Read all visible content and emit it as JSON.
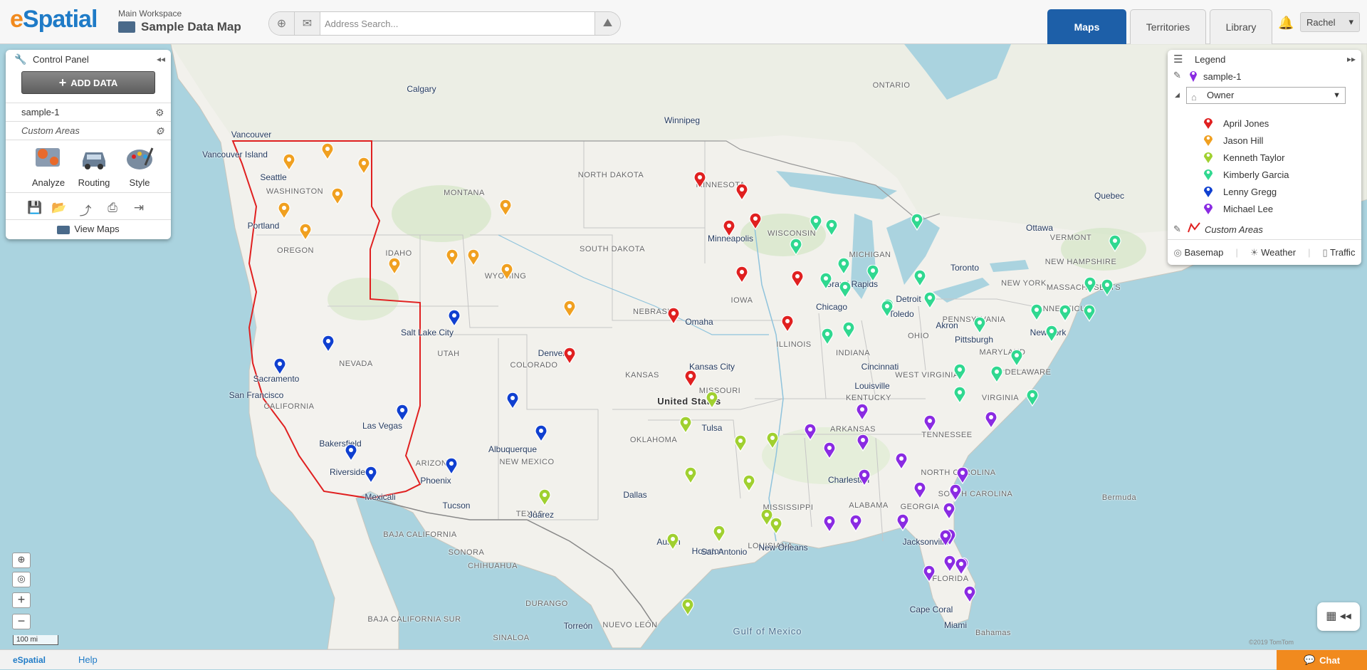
{
  "header": {
    "logo_prefix": "e",
    "logo_rest": "Spatial",
    "workspace": "Main Workspace",
    "map_title": "Sample Data Map",
    "search_placeholder": "Address Search...",
    "tabs": [
      {
        "label": "Maps",
        "active": true
      },
      {
        "label": "Territories",
        "active": false
      },
      {
        "label": "Library",
        "active": false
      }
    ],
    "user": "Rachel"
  },
  "control_panel": {
    "title": "Control Panel",
    "add_data_label": "ADD DATA",
    "dataset": "sample-1",
    "custom_areas": "Custom Areas",
    "tools": [
      {
        "label": "Analyze",
        "icon": "analyze-icon"
      },
      {
        "label": "Routing",
        "icon": "car-icon"
      },
      {
        "label": "Style",
        "icon": "palette-icon"
      }
    ],
    "actions": [
      "save-icon",
      "folder-open-icon",
      "share-icon",
      "print-icon",
      "export-icon"
    ],
    "view_maps": "View Maps"
  },
  "legend": {
    "title": "Legend",
    "layer": "sample-1",
    "group_by": "Owner",
    "owners": [
      {
        "name": "April Jones",
        "color": "#e02020"
      },
      {
        "name": "Jason Hill",
        "color": "#f0a020"
      },
      {
        "name": "Kenneth Taylor",
        "color": "#a0d030"
      },
      {
        "name": "Kimberly Garcia",
        "color": "#30d890"
      },
      {
        "name": "Lenny Gregg",
        "color": "#1040d0"
      },
      {
        "name": "Michael Lee",
        "color": "#8a2be2"
      }
    ],
    "custom_areas": "Custom Areas",
    "footer": [
      "Basemap",
      "Weather",
      "Traffic"
    ]
  },
  "map": {
    "scale": "100 mi",
    "copyright": "©2019 TomTom",
    "labels": [
      {
        "t": "Calgary",
        "k": "city"
      },
      {
        "t": "Winnipeg",
        "k": "city"
      },
      {
        "t": "ONTARIO",
        "k": "region"
      },
      {
        "t": "Vancouver",
        "k": "city"
      },
      {
        "t": "Vancouver Island",
        "k": "city"
      },
      {
        "t": "Seattle",
        "k": "city"
      },
      {
        "t": "WASHINGTON",
        "k": "region"
      },
      {
        "t": "Portland",
        "k": "city"
      },
      {
        "t": "OREGON",
        "k": "region"
      },
      {
        "t": "MONTANA",
        "k": "region"
      },
      {
        "t": "IDAHO",
        "k": "region"
      },
      {
        "t": "WYOMING",
        "k": "region"
      },
      {
        "t": "NORTH DAKOTA",
        "k": "region"
      },
      {
        "t": "SOUTH DAKOTA",
        "k": "region"
      },
      {
        "t": "MINNESOTA",
        "k": "region"
      },
      {
        "t": "Minneapolis",
        "k": "city"
      },
      {
        "t": "WISCONSIN",
        "k": "region"
      },
      {
        "t": "MICHIGAN",
        "k": "region"
      },
      {
        "t": "Quebec",
        "k": "city"
      },
      {
        "t": "Ottawa",
        "k": "city"
      },
      {
        "t": "Toronto",
        "k": "city"
      },
      {
        "t": "VERMONT",
        "k": "region"
      },
      {
        "t": "NEW HAMPSHIRE",
        "k": "region"
      },
      {
        "t": "MASSACHUSETTS",
        "k": "region"
      },
      {
        "t": "NEW YORK",
        "k": "region"
      },
      {
        "t": "CONNECTICUT",
        "k": "region"
      },
      {
        "t": "New York",
        "k": "city"
      },
      {
        "t": "Grand Rapids",
        "k": "city"
      },
      {
        "t": "Detroit",
        "k": "city"
      },
      {
        "t": "Toledo",
        "k": "city"
      },
      {
        "t": "Akron",
        "k": "city"
      },
      {
        "t": "PENNSYLVANIA",
        "k": "region"
      },
      {
        "t": "Pittsburgh",
        "k": "city"
      },
      {
        "t": "Chicago",
        "k": "city"
      },
      {
        "t": "IOWA",
        "k": "region"
      },
      {
        "t": "NEBRASKA",
        "k": "region"
      },
      {
        "t": "Omaha",
        "k": "city"
      },
      {
        "t": "Salt Lake City",
        "k": "city"
      },
      {
        "t": "UTAH",
        "k": "region"
      },
      {
        "t": "NEVADA",
        "k": "region"
      },
      {
        "t": "Sacramento",
        "k": "city"
      },
      {
        "t": "San Francisco",
        "k": "city"
      },
      {
        "t": "CALIFORNIA",
        "k": "region"
      },
      {
        "t": "Denver",
        "k": "city"
      },
      {
        "t": "COLORADO",
        "k": "region"
      },
      {
        "t": "KANSAS",
        "k": "region"
      },
      {
        "t": "Kansas City",
        "k": "city"
      },
      {
        "t": "MISSOURI",
        "k": "region"
      },
      {
        "t": "ILLINOIS",
        "k": "region"
      },
      {
        "t": "INDIANA",
        "k": "region"
      },
      {
        "t": "OHIO",
        "k": "region"
      },
      {
        "t": "Cincinnati",
        "k": "city"
      },
      {
        "t": "WEST VIRGINIA",
        "k": "region"
      },
      {
        "t": "MARYLAND",
        "k": "region"
      },
      {
        "t": "DELAWARE",
        "k": "region"
      },
      {
        "t": "VIRGINIA",
        "k": "region"
      },
      {
        "t": "Louisville",
        "k": "city"
      },
      {
        "t": "KENTUCKY",
        "k": "region"
      },
      {
        "t": "United States",
        "k": "country"
      },
      {
        "t": "Las Vegas",
        "k": "city"
      },
      {
        "t": "Bakersfield",
        "k": "city"
      },
      {
        "t": "Riverside",
        "k": "city"
      },
      {
        "t": "Mexicali",
        "k": "city"
      },
      {
        "t": "ARIZONA",
        "k": "region"
      },
      {
        "t": "Phoenix",
        "k": "city"
      },
      {
        "t": "Tucson",
        "k": "city"
      },
      {
        "t": "Albuquerque",
        "k": "city"
      },
      {
        "t": "NEW MEXICO",
        "k": "region"
      },
      {
        "t": "OKLAHOMA",
        "k": "region"
      },
      {
        "t": "Tulsa",
        "k": "city"
      },
      {
        "t": "ARKANSAS",
        "k": "region"
      },
      {
        "t": "TENNESSEE",
        "k": "region"
      },
      {
        "t": "NORTH CAROLINA",
        "k": "region"
      },
      {
        "t": "SOUTH CAROLINA",
        "k": "region"
      },
      {
        "t": "Charleston",
        "k": "city"
      },
      {
        "t": "ALABAMA",
        "k": "region"
      },
      {
        "t": "GEORGIA",
        "k": "region"
      },
      {
        "t": "MISSISSIPPI",
        "k": "region"
      },
      {
        "t": "Dallas",
        "k": "city"
      },
      {
        "t": "TEXAS",
        "k": "region"
      },
      {
        "t": "Juárez",
        "k": "city"
      },
      {
        "t": "BAJA CALIFORNIA",
        "k": "region"
      },
      {
        "t": "SONORA",
        "k": "region"
      },
      {
        "t": "CHIHUAHUA",
        "k": "region"
      },
      {
        "t": "Austin",
        "k": "city"
      },
      {
        "t": "Houston",
        "k": "city"
      },
      {
        "t": "San Antonio",
        "k": "city"
      },
      {
        "t": "LOUISIANA",
        "k": "region"
      },
      {
        "t": "New Orleans",
        "k": "city"
      },
      {
        "t": "Jacksonville",
        "k": "city"
      },
      {
        "t": "FLORIDA",
        "k": "region"
      },
      {
        "t": "Cape Coral",
        "k": "city"
      },
      {
        "t": "Miami",
        "k": "city"
      },
      {
        "t": "Bermuda",
        "k": "region"
      },
      {
        "t": "Gulf of Mexico",
        "k": "water"
      },
      {
        "t": "Bahamas",
        "k": "region"
      },
      {
        "t": "DURANGO",
        "k": "region"
      },
      {
        "t": "NUEVO LEÓN",
        "k": "region"
      },
      {
        "t": "Torreón",
        "k": "city"
      },
      {
        "t": "BAJA CALIFORNIA SUR",
        "k": "region"
      },
      {
        "t": "SINALOA",
        "k": "region"
      }
    ]
  },
  "footer": {
    "brand": "eSpatial",
    "help": "Help",
    "chat": "Chat"
  }
}
